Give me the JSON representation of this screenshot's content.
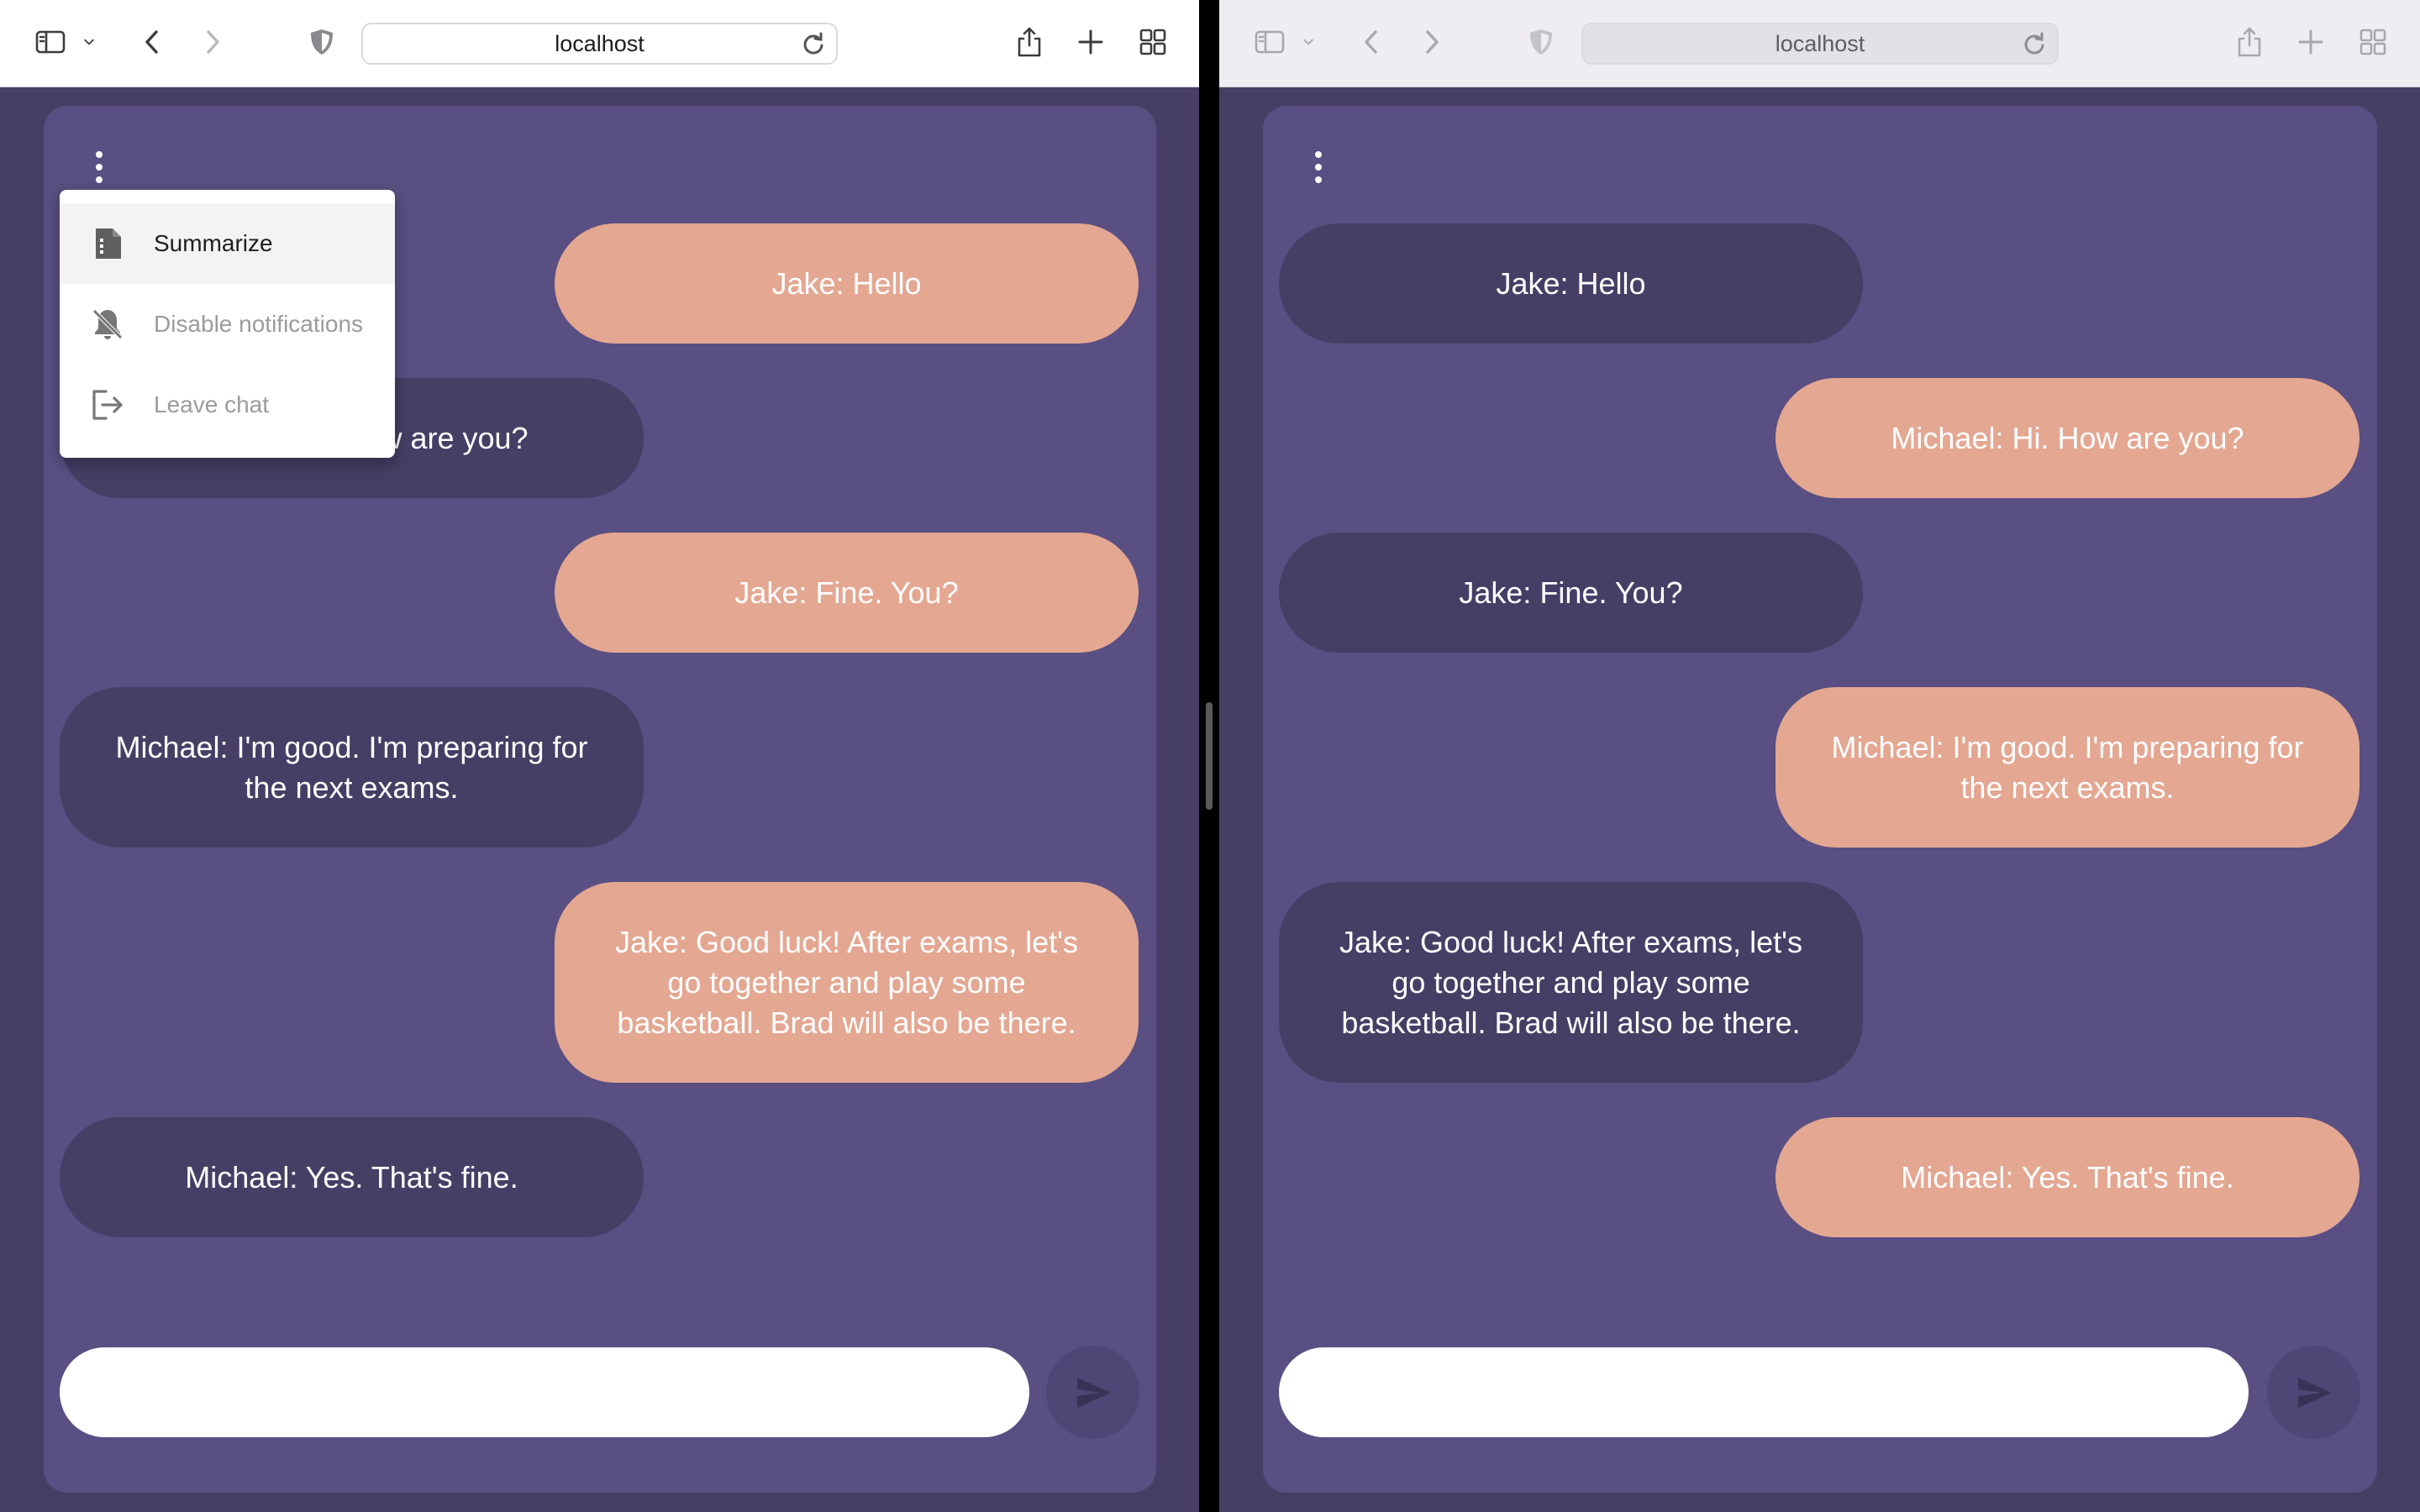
{
  "browser": {
    "address": "localhost"
  },
  "chat": {
    "messages": [
      {
        "sender": "Jake",
        "text": "Jake: Hello"
      },
      {
        "sender": "Michael",
        "text": "Michael: Hi. How are you?"
      },
      {
        "sender": "Jake",
        "text": "Jake: Fine. You?"
      },
      {
        "sender": "Michael",
        "text": "Michael: I'm good. I'm preparing for the next exams."
      },
      {
        "sender": "Jake",
        "text": "Jake: Good luck! After exams, let's go together and play some basketball. Brad will also be there."
      },
      {
        "sender": "Michael",
        "text": "Michael: Yes. That's fine."
      }
    ],
    "composer_value": ""
  },
  "left_window": {
    "self": "Jake",
    "menu_open": true
  },
  "right_window": {
    "self": "Michael",
    "menu_open": false
  },
  "menu": {
    "items": [
      {
        "label": "Summarize",
        "icon": "summarize-icon",
        "state": "highlighted"
      },
      {
        "label": "Disable notifications",
        "icon": "notifications-off-icon",
        "state": "disabled"
      },
      {
        "label": "Leave chat",
        "icon": "logout-icon",
        "state": "disabled"
      }
    ]
  },
  "colors": {
    "page_bg": "#473e66",
    "card_bg": "#594f82",
    "own_bubble": "#e4a792",
    "other_bubble": "#473e66",
    "send_button": "#4f4675"
  }
}
